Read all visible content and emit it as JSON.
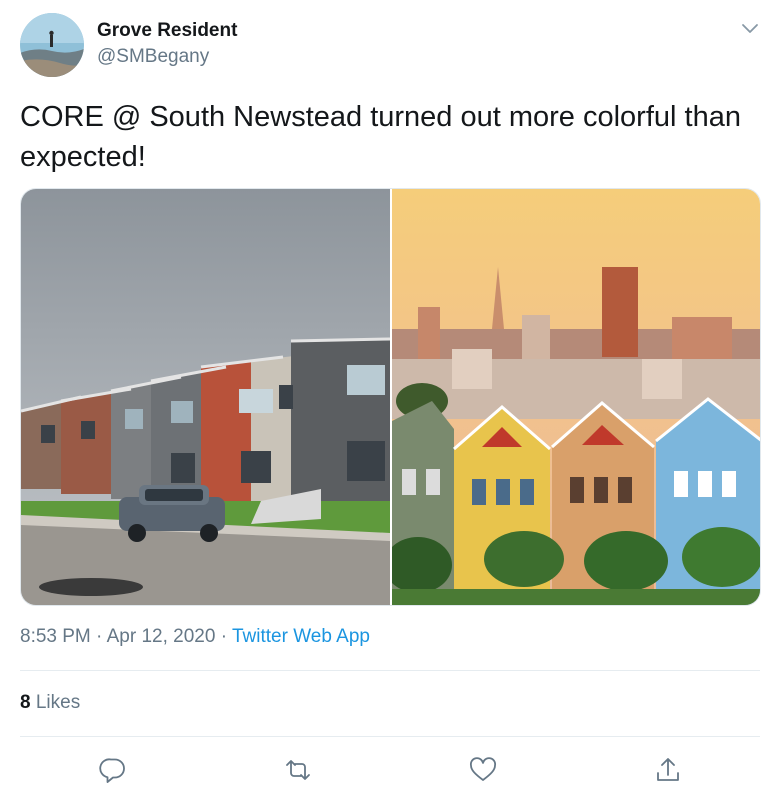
{
  "user": {
    "name": "Grove Resident",
    "handle": "@SMBegany"
  },
  "tweet": {
    "text": "CORE @ South Newstead turned out more colorful than expected!",
    "time": "8:53 PM",
    "date": "Apr 12, 2020",
    "separator": "·",
    "source": "Twitter Web App"
  },
  "stats": {
    "likes_count": "8",
    "likes_label": " Likes"
  },
  "icons": {
    "caret": "chevron-down-icon",
    "reply": "reply-icon",
    "retweet": "retweet-icon",
    "like": "heart-icon",
    "share": "share-icon"
  },
  "colors": {
    "text": "#14171a",
    "secondary": "#657786",
    "link": "#1b95e0",
    "divider": "#e6ecf0"
  }
}
